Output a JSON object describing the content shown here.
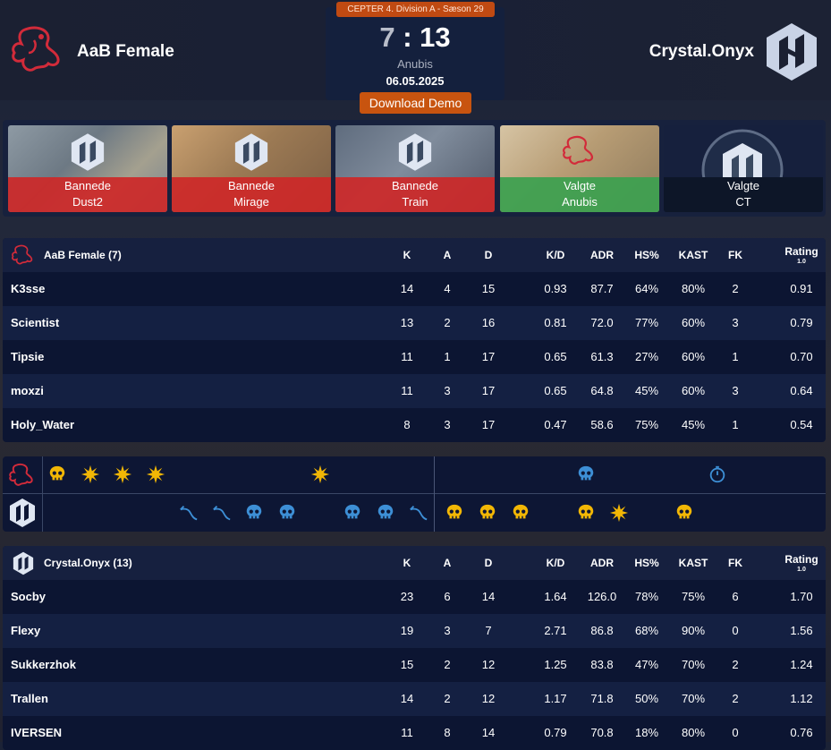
{
  "header": {
    "league": "CEPTER 4. Division A - Sæson 29",
    "score_left": "7",
    "score_sep": ":",
    "score_right": "13",
    "map": "Anubis",
    "date": "06.05.2025",
    "download_label": "Download Demo",
    "team_left": "AaB Female",
    "team_right": "Crystal.Onyx"
  },
  "veto": [
    {
      "action": "Bannede",
      "map": "Dust2",
      "type": "ban",
      "logo": "onyx"
    },
    {
      "action": "Bannede",
      "map": "Mirage",
      "type": "ban",
      "logo": "onyx"
    },
    {
      "action": "Bannede",
      "map": "Train",
      "type": "ban",
      "logo": "onyx"
    },
    {
      "action": "Valgte",
      "map": "Anubis",
      "type": "pick",
      "logo": "aab"
    },
    {
      "action": "Valgte",
      "map": "CT",
      "type": "side",
      "logo": "onyx"
    }
  ],
  "columns": {
    "k": "K",
    "a": "A",
    "d": "D",
    "kd": "K/D",
    "adr": "ADR",
    "hs": "HS%",
    "kast": "KAST",
    "fk": "FK",
    "rating": "Rating",
    "rating_sub": "1.0"
  },
  "team1": {
    "header": "AaB Female (7)",
    "players": [
      {
        "name": "K3sse",
        "k": "14",
        "a": "4",
        "d": "15",
        "kd": "0.93",
        "adr": "87.7",
        "hs": "64%",
        "kast": "80%",
        "fk": "2",
        "rating": "0.91"
      },
      {
        "name": "Scientist",
        "k": "13",
        "a": "2",
        "d": "16",
        "kd": "0.81",
        "adr": "72.0",
        "hs": "77%",
        "kast": "60%",
        "fk": "3",
        "rating": "0.79"
      },
      {
        "name": "Tipsie",
        "k": "11",
        "a": "1",
        "d": "17",
        "kd": "0.65",
        "adr": "61.3",
        "hs": "27%",
        "kast": "60%",
        "fk": "1",
        "rating": "0.70"
      },
      {
        "name": "moxzi",
        "k": "11",
        "a": "3",
        "d": "17",
        "kd": "0.65",
        "adr": "64.8",
        "hs": "45%",
        "kast": "60%",
        "fk": "3",
        "rating": "0.64"
      },
      {
        "name": "Holy_Water",
        "k": "8",
        "a": "3",
        "d": "17",
        "kd": "0.47",
        "adr": "58.6",
        "hs": "75%",
        "kast": "45%",
        "fk": "1",
        "rating": "0.54"
      }
    ]
  },
  "team2": {
    "header": "Crystal.Onyx (13)",
    "players": [
      {
        "name": "Socby",
        "k": "23",
        "a": "6",
        "d": "14",
        "kd": "1.64",
        "adr": "126.0",
        "hs": "78%",
        "kast": "75%",
        "fk": "6",
        "rating": "1.70"
      },
      {
        "name": "Flexy",
        "k": "19",
        "a": "3",
        "d": "7",
        "kd": "2.71",
        "adr": "86.8",
        "hs": "68%",
        "kast": "90%",
        "fk": "0",
        "rating": "1.56"
      },
      {
        "name": "Sukkerzhok",
        "k": "15",
        "a": "2",
        "d": "12",
        "kd": "1.25",
        "adr": "83.8",
        "hs": "47%",
        "kast": "70%",
        "fk": "2",
        "rating": "1.24"
      },
      {
        "name": "Trallen",
        "k": "14",
        "a": "2",
        "d": "12",
        "kd": "1.17",
        "adr": "71.8",
        "hs": "50%",
        "kast": "70%",
        "fk": "2",
        "rating": "1.12"
      },
      {
        "name": "IVERSEN",
        "k": "11",
        "a": "8",
        "d": "14",
        "kd": "0.79",
        "adr": "70.8",
        "hs": "18%",
        "kast": "80%",
        "fk": "0",
        "rating": "0.76"
      }
    ]
  },
  "rounds": {
    "team1": [
      "skull-t",
      "bomb",
      "bomb",
      "bomb",
      "",
      "",
      "",
      "",
      "bomb",
      "",
      "",
      "",
      "",
      "",
      "",
      "",
      "skull-ct",
      "",
      "",
      "",
      "timer",
      "",
      "",
      ""
    ],
    "team2": [
      "",
      "",
      "",
      "",
      "defuse",
      "defuse",
      "skull-ct",
      "skull-ct",
      "",
      "skull-ct",
      "skull-ct",
      "defuse",
      "skull-t",
      "skull-t",
      "skull-t",
      "",
      "skull-t",
      "bomb",
      "",
      "skull-t",
      "",
      "",
      "",
      ""
    ],
    "colors": {
      "t": "#f2b705",
      "ct": "#3d8fd6",
      "bomb": "#f2b705"
    }
  }
}
